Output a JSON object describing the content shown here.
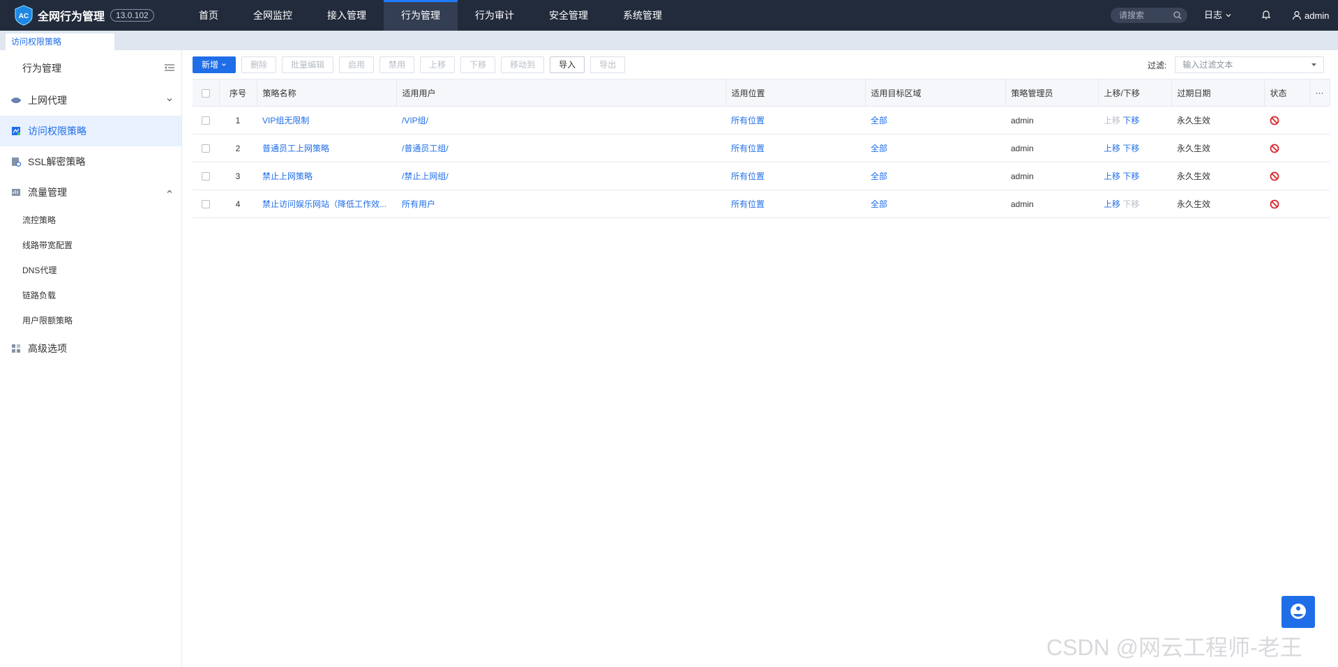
{
  "app": {
    "name": "全网行为管理",
    "version": "13.0.102",
    "logo_text": "AC"
  },
  "nav": {
    "items": [
      {
        "label": "首页"
      },
      {
        "label": "全网监控"
      },
      {
        "label": "接入管理"
      },
      {
        "label": "行为管理",
        "active": true
      },
      {
        "label": "行为审计"
      },
      {
        "label": "安全管理"
      },
      {
        "label": "系统管理"
      }
    ]
  },
  "header": {
    "search_placeholder": "请搜索",
    "log_label": "日志",
    "user_label": "admin"
  },
  "tabs": {
    "current": "访问权限策略"
  },
  "sidebar": {
    "title": "行为管理",
    "items": [
      {
        "label": "上网代理",
        "icon": "globe-icon",
        "chevron": "down"
      },
      {
        "label": "访问权限策略",
        "icon": "access-policy-icon",
        "active": true
      },
      {
        "label": "SSL解密策略",
        "icon": "ssl-icon"
      },
      {
        "label": "流量管理",
        "icon": "traffic-icon",
        "chevron": "up"
      }
    ],
    "sub_items": [
      {
        "label": "流控策略"
      },
      {
        "label": "线路带宽配置"
      },
      {
        "label": "DNS代理"
      },
      {
        "label": "链路负载"
      },
      {
        "label": "用户限额策略"
      }
    ],
    "advanced": {
      "label": "高级选项",
      "icon": "grid-icon"
    }
  },
  "toolbar": {
    "add": "新增",
    "delete": "删除",
    "batch_edit": "批量编辑",
    "enable": "启用",
    "disable": "禁用",
    "move_up": "上移",
    "move_down": "下移",
    "move_to": "移动到",
    "import": "导入",
    "export": "导出"
  },
  "filter": {
    "label": "过滤:",
    "placeholder": "输入过滤文本"
  },
  "table": {
    "columns": {
      "index": "序号",
      "name": "策略名称",
      "users": "适用用户",
      "location": "适用位置",
      "target_zone": "适用目标区域",
      "admin": "策略管理员",
      "move": "上移/下移",
      "expire": "过期日期",
      "status": "状态",
      "more": "···"
    },
    "rows": [
      {
        "index": "1",
        "name": "VIP组无限制",
        "users": "/VIP组/",
        "location": "所有位置",
        "target_zone": "全部",
        "admin": "admin",
        "up": "上移",
        "down": "下移",
        "expire": "永久生效"
      },
      {
        "index": "2",
        "name": "普通员工上网策略",
        "users": "/普通员工组/",
        "location": "所有位置",
        "target_zone": "全部",
        "admin": "admin",
        "up": "上移",
        "down": "下移",
        "expire": "永久生效"
      },
      {
        "index": "3",
        "name": "禁止上网策略",
        "users": "/禁止上网组/",
        "location": "所有位置",
        "target_zone": "全部",
        "admin": "admin",
        "up": "上移",
        "down": "下移",
        "expire": "永久生效"
      },
      {
        "index": "4",
        "name": "禁止访问娱乐网站（降低工作效...",
        "users": "所有用户",
        "location": "所有位置",
        "target_zone": "全部",
        "admin": "admin",
        "up": "上移",
        "down": "下移",
        "expire": "永久生效"
      }
    ]
  },
  "watermark": "CSDN @网云工程师-老王",
  "colors": {
    "topbar": "#222b3c",
    "accent": "#1f6ee8",
    "disabled_status": "#d9252a"
  }
}
